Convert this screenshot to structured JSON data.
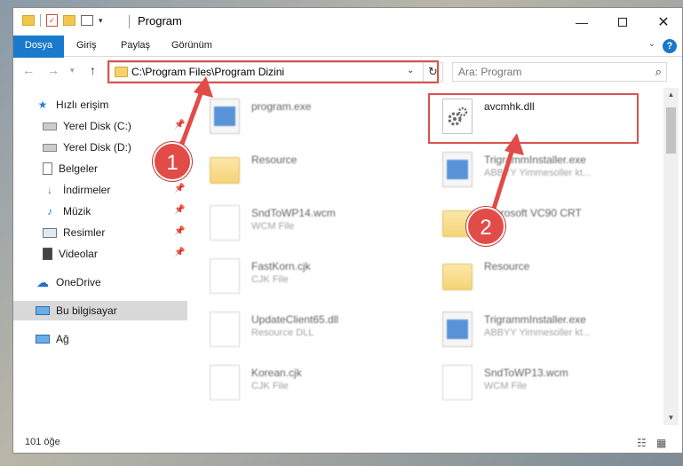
{
  "window": {
    "title": "Program",
    "icons": [
      "folder-icon",
      "properties-icon",
      "new-folder-icon",
      "view-icon"
    ]
  },
  "ribbon": {
    "tabs": [
      {
        "label": "Dosya"
      },
      {
        "label": "Giriş"
      },
      {
        "label": "Paylaş"
      },
      {
        "label": "Görünüm"
      }
    ],
    "help": "?"
  },
  "navigation": {
    "address": "C:\\Program Files\\Program Dizini",
    "search_placeholder": "Ara: Program"
  },
  "sidebar": {
    "items": [
      {
        "label": "Hızlı erişim",
        "icon": "star-icon",
        "pinned": false
      },
      {
        "label": "Yerel Disk (C:)",
        "icon": "drive-icon",
        "pinned": true
      },
      {
        "label": "Yerel Disk (D:)",
        "icon": "drive-icon",
        "pinned": true
      },
      {
        "label": "Belgeler",
        "icon": "document-icon",
        "pinned": true
      },
      {
        "label": "İndirmeler",
        "icon": "download-icon",
        "pinned": true
      },
      {
        "label": "Müzik",
        "icon": "music-icon",
        "pinned": true
      },
      {
        "label": "Resimler",
        "icon": "pictures-icon",
        "pinned": true
      },
      {
        "label": "Videolar",
        "icon": "video-icon",
        "pinned": true
      },
      {
        "label": "OneDrive",
        "icon": "cloud-icon",
        "pinned": false
      },
      {
        "label": "Bu bilgisayar",
        "icon": "computer-icon",
        "pinned": false,
        "selected": true
      },
      {
        "label": "Ağ",
        "icon": "network-icon",
        "pinned": false
      }
    ]
  },
  "files": {
    "left": [
      {
        "name": "program.exe",
        "sub": "",
        "type": "app"
      },
      {
        "name": "Resource",
        "sub": "",
        "type": "folder"
      },
      {
        "name": "SndToWP14.wcm",
        "sub": "WCM File",
        "type": "page"
      },
      {
        "name": "FastKorn.cjk",
        "sub": "CJK File",
        "type": "page"
      },
      {
        "name": "UpdateClient65.dll",
        "sub": "Resource DLL",
        "type": "page"
      },
      {
        "name": "Korean.cjk",
        "sub": "CJK File",
        "type": "page"
      }
    ],
    "right": [
      {
        "name": "avcmhk.dll",
        "sub": "",
        "type": "dll",
        "highlighted": true
      },
      {
        "name": "TrigrammInstaller.exe",
        "sub": "ABBYY Yimmesoller kt...",
        "type": "app"
      },
      {
        "name": "Microsoft VC90 CRT",
        "sub": "",
        "type": "folder"
      },
      {
        "name": "Resource",
        "sub": "",
        "type": "folder"
      },
      {
        "name": "TrigrammInstaller.exe",
        "sub": "ABBYY Yimmesoller kt...",
        "type": "app"
      },
      {
        "name": "SndToWP13.wcm",
        "sub": "WCM File",
        "type": "page"
      }
    ]
  },
  "status": {
    "count": "101 öğe"
  },
  "annotations": {
    "step1": "1",
    "step2": "2",
    "color": "#e14b48"
  }
}
